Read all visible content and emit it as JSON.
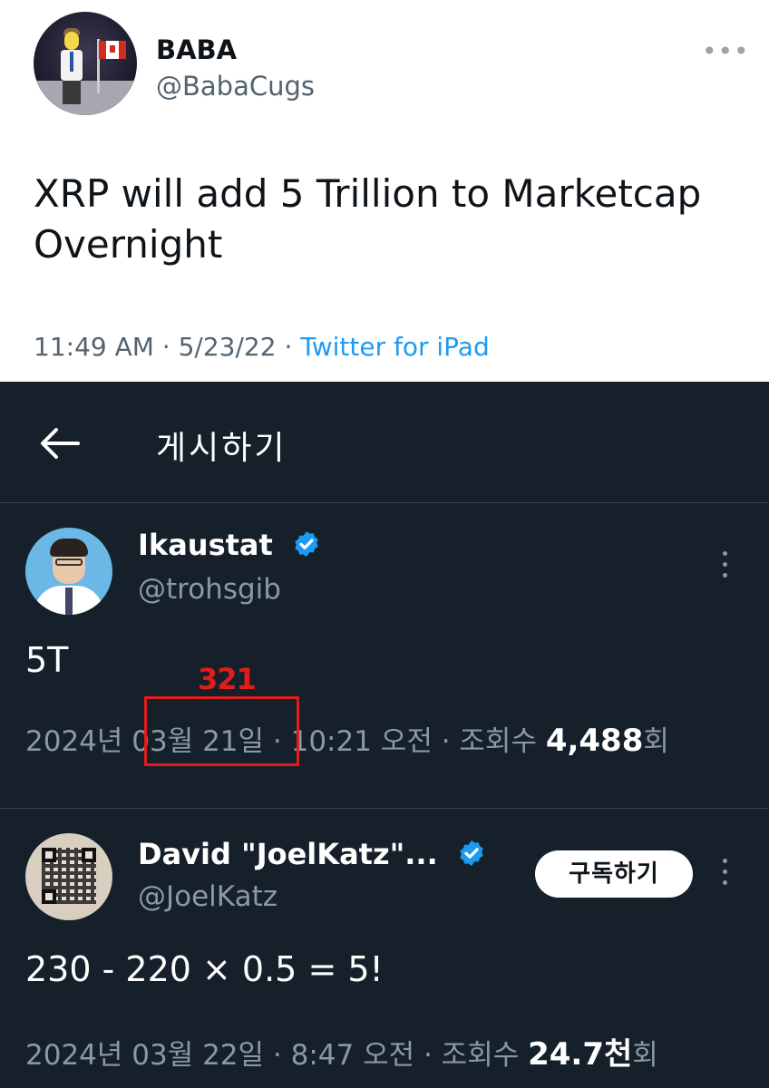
{
  "original_tweet": {
    "name": "BABA",
    "handle": "@BabaCugs",
    "more_icon": "ellipsis-horizontal-icon",
    "text": "XRP will add 5 Trillion to Marketcap Overnight",
    "meta_time": "11:49 AM · 5/23/22 · ",
    "meta_source": "Twitter for iPad"
  },
  "header": {
    "back_icon": "arrow-left-icon",
    "title": "게시하기"
  },
  "replies": [
    {
      "name": "Ikaustat",
      "handle": "@trohsgib",
      "verified": true,
      "text": "5T",
      "meta_prefix": "2024년 03월 21일 · 10:21 오전 · 조회수 ",
      "views": "4,488",
      "views_suffix": "회"
    },
    {
      "name": "David \"JoelKatz\"...",
      "handle": "@JoelKatz",
      "verified": true,
      "subscribe_label": "구독하기",
      "text": "230 - 220 × 0.5 = 5!",
      "meta_prefix": "2024년 03월 22일 · 8:47 오전 · 조회수 ",
      "views": "24.7천",
      "views_suffix": "회"
    }
  ],
  "annotation": {
    "label": "321",
    "color": "#e21b1b"
  },
  "colors": {
    "dark_bg": "#15202b",
    "accent": "#1d9bf0",
    "divider": "#38444d"
  }
}
